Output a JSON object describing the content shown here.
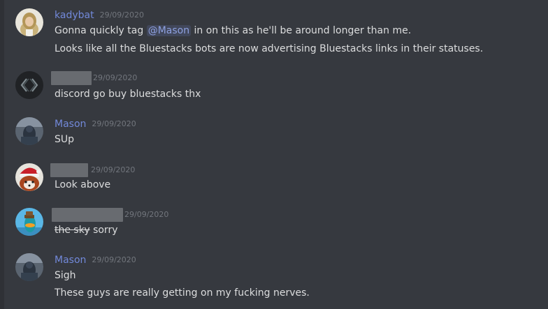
{
  "messages": [
    {
      "author": "kadybat",
      "timestamp": "29/09/2020",
      "lines": {
        "l1_before": "Gonna quickly tag ",
        "l1_mention": "@Mason",
        "l1_after": " in on this as he'll be around longer than me.",
        "l2": "Looks like all the Bluestacks bots are now advertising Bluestacks links in their statuses."
      }
    },
    {
      "author": "",
      "timestamp": "29/09/2020",
      "lines": {
        "l1": "discord go buy bluestacks thx"
      }
    },
    {
      "author": "Mason",
      "timestamp": "29/09/2020",
      "lines": {
        "l1": "SUp"
      }
    },
    {
      "author": "",
      "timestamp": "29/09/2020",
      "lines": {
        "l1": "Look above"
      }
    },
    {
      "author": "",
      "timestamp": "29/09/2020",
      "lines": {
        "l1_strike": "the sky",
        "l1_after": " sorry"
      }
    },
    {
      "author": "Mason",
      "timestamp": "29/09/2020",
      "lines": {
        "l1": "Sigh",
        "l2": "These guys are really getting on my fucking nerves."
      }
    }
  ],
  "colors": {
    "background": "#36393f",
    "username": "#7289da",
    "text": "#dcddde",
    "timestamp": "#72767d",
    "redaction": "#686b70"
  }
}
